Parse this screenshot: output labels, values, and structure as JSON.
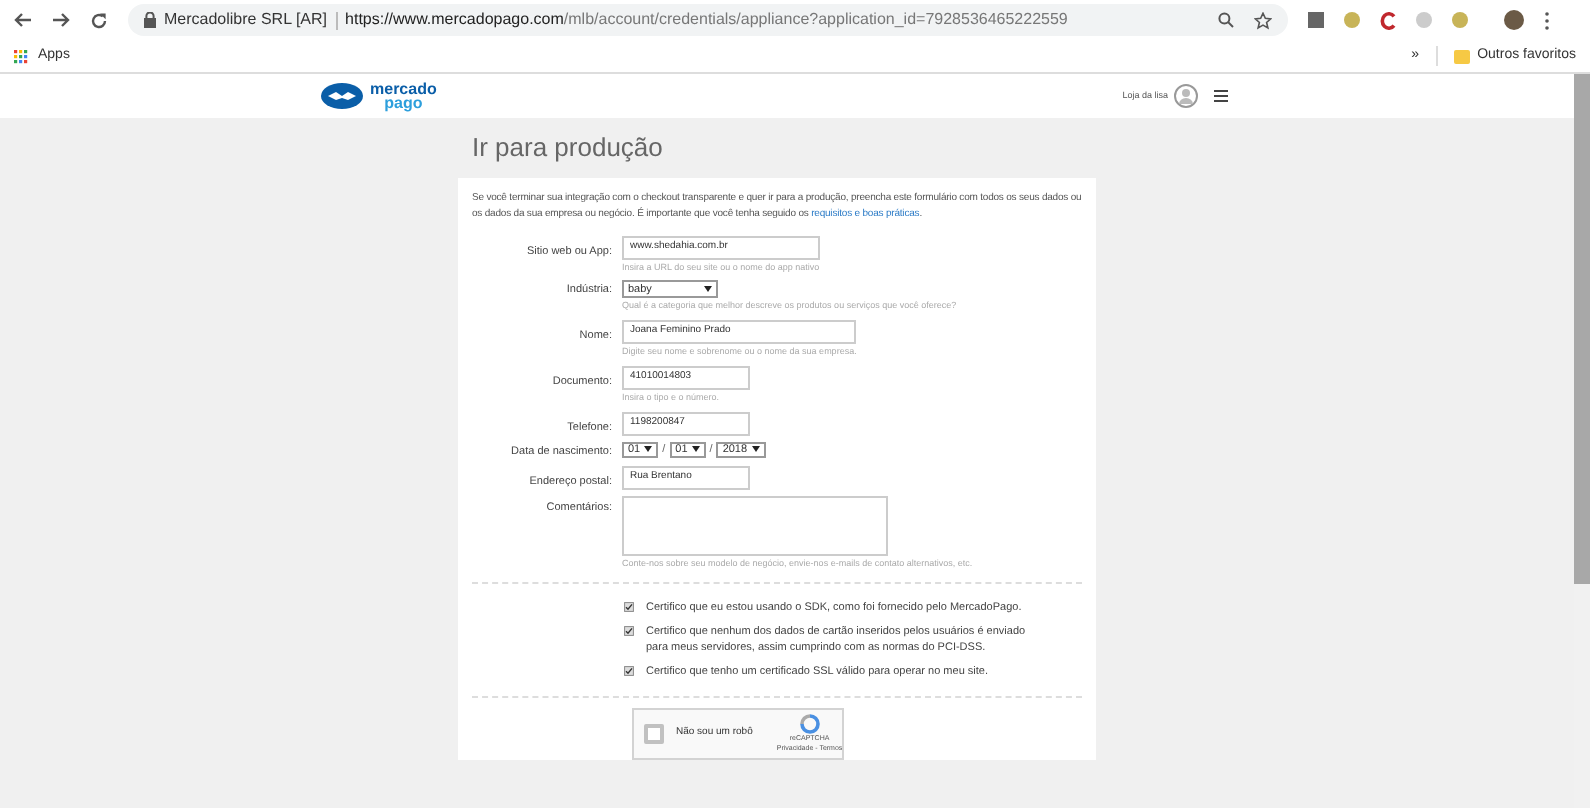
{
  "browser": {
    "site_name": "Mercadolibre SRL [AR]",
    "url_domain": "https://www.mercadopago.com",
    "url_path": "/mlb/account/credentials/appliance?application_id=7928536465222559",
    "bookmarks": [
      {
        "label": "Apps"
      }
    ],
    "other_bookmarks": "Outros favoritos",
    "overflow": "»"
  },
  "header": {
    "logo_top": "mercado",
    "logo_bottom": "pago",
    "user_name": "Loja da lisa"
  },
  "page_title": "Ir para produção",
  "intro": "Se você terminar sua integração com o checkout transparente e quer ir para a produção, preencha este formulário com todos os seus dados ou os dados da sua empresa ou negócio. É importante que você tenha seguido os ",
  "intro_link": "requisitos e boas práticas",
  "intro_end": ".",
  "fields": [
    {
      "kind": "text",
      "label": "Sitio web ou App:",
      "value": "www.shedahia.com.br",
      "hint": "Insira a URL do seu site ou o nome do app nativo"
    },
    {
      "kind": "select",
      "label": "Indústria:",
      "value": "baby",
      "hint": "Qual é a categoria que melhor descreve os produtos ou serviços que você oferece?"
    },
    {
      "kind": "text",
      "label": "Nome:",
      "value": "Joana Feminino Prado",
      "hint": "Digite seu nome e sobrenome ou o nome da sua empresa."
    },
    {
      "kind": "text",
      "label": "Documento:",
      "value": "41010014803",
      "hint": "Insira o tipo e o número."
    },
    {
      "kind": "text",
      "label": "Telefone:",
      "value": "1198200847"
    },
    {
      "kind": "date",
      "label": "Data de nascimento:",
      "parts": [
        "01",
        "01",
        "2018"
      ],
      "separator": "/"
    },
    {
      "kind": "text",
      "label": "Endereço postal:",
      "value": "Rua Brentano"
    },
    {
      "kind": "textarea",
      "label": "Comentários:",
      "hint": "Conte-nos sobre seu modelo de negócio, envie-nos e-mails de contato alternativos, etc."
    }
  ],
  "certifications": [
    {
      "text": "Certifico que eu estou usando o SDK, como foi fornecido pelo MercadoPago.",
      "checked": true
    },
    {
      "text": "Certifico que nenhum dos dados de cartão inseridos pelos usuários é enviado para meus servidores, assim cumprindo com as normas do PCI-DSS.",
      "checked": true
    },
    {
      "text": "Certifico que tenho um certificado SSL válido para operar no meu site.",
      "checked": true
    }
  ],
  "captcha": {
    "label": "Não sou um robô",
    "checked": false,
    "brand": "reCAPTCHA",
    "links": "Privacidade - Termos"
  }
}
